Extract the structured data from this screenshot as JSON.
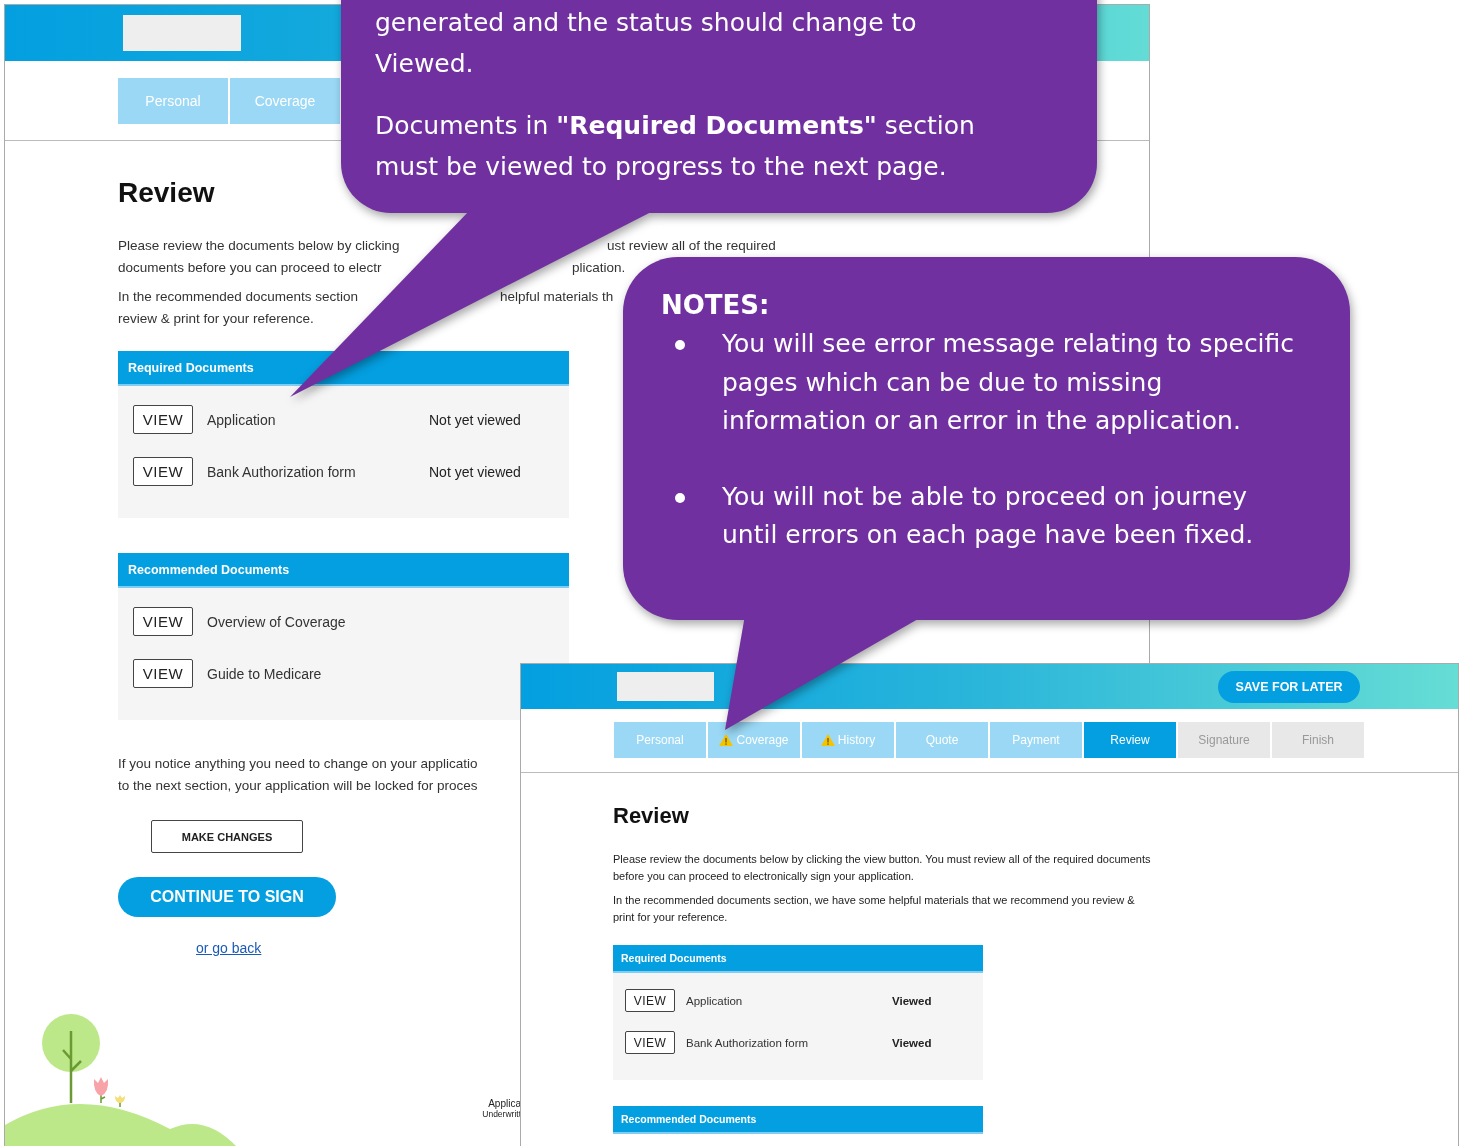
{
  "back_window": {
    "tabs": [
      {
        "label": "Personal",
        "selected": false,
        "disabled": false
      },
      {
        "label": "Coverage",
        "selected": false,
        "disabled": false
      }
    ],
    "heading": "Review",
    "intro_fragments": [
      {
        "left": "Please review the documents below by clicking",
        "right": "ust review all of the required"
      },
      {
        "left": "documents before you can proceed to electr",
        "right": "plication."
      },
      {
        "left": "In the recommended documents section",
        "right": "helpful materials th"
      },
      {
        "left": "review & print for your reference."
      }
    ],
    "required_documents": {
      "title": "Required Documents",
      "items": [
        {
          "button": "VIEW",
          "name": "Application",
          "status": "Not yet viewed",
          "viewed": false
        },
        {
          "button": "VIEW",
          "name": "Bank Authorization form",
          "status": "Not yet viewed",
          "viewed": false
        }
      ]
    },
    "recommended_documents": {
      "title": "Recommended Documents",
      "items": [
        {
          "button": "VIEW",
          "name": "Overview of Coverage"
        },
        {
          "button": "VIEW",
          "name": "Guide to Medicare"
        }
      ]
    },
    "change_note_lines": [
      "If you notice anything you need to change on your applicatio",
      "to the next section, your application will be locked for proces"
    ],
    "make_changes_button": "MAKE CHANGES",
    "continue_button": "CONTINUE TO SIGN",
    "back_link": "or go back",
    "footer_lines": [
      "Applica",
      "Underwritt"
    ]
  },
  "front_window": {
    "save_button": "SAVE FOR LATER",
    "tabs": [
      {
        "label": "Personal",
        "selected": false,
        "disabled": false,
        "warning": false
      },
      {
        "label": "Coverage",
        "selected": false,
        "disabled": false,
        "warning": true
      },
      {
        "label": "History",
        "selected": false,
        "disabled": false,
        "warning": true
      },
      {
        "label": "Quote",
        "selected": false,
        "disabled": false,
        "warning": false
      },
      {
        "label": "Payment",
        "selected": false,
        "disabled": false,
        "warning": false
      },
      {
        "label": "Review",
        "selected": true,
        "disabled": false,
        "warning": false
      },
      {
        "label": "Signature",
        "selected": false,
        "disabled": true,
        "warning": false
      },
      {
        "label": "Finish",
        "selected": false,
        "disabled": true,
        "warning": false
      }
    ],
    "heading": "Review",
    "paragraphs": [
      "Please review the documents below by clicking the view button. You must review all of the required documents before you can proceed to electronically sign your application.",
      "In the recommended documents section, we have some helpful materials that we recommend you review & print for your reference."
    ],
    "required_documents": {
      "title": "Required Documents",
      "items": [
        {
          "button": "VIEW",
          "name": "Application",
          "status": "Viewed",
          "viewed": true
        },
        {
          "button": "VIEW",
          "name": "Bank Authorization form",
          "status": "Viewed",
          "viewed": true
        }
      ]
    },
    "recommended_documents": {
      "title": "Recommended Documents"
    }
  },
  "callouts": [
    {
      "paragraphs": [
        "generated and the status should change to Viewed.",
        "Documents in **\"Required Documents\"** section must be viewed to progress to the next page."
      ]
    },
    {
      "title": "NOTES:",
      "bullets": [
        "You will see error message relating to specific pages which can be due to missing information or an error in the application.",
        "You will not be able to proceed on journey until errors on each page have been fixed."
      ]
    }
  ]
}
